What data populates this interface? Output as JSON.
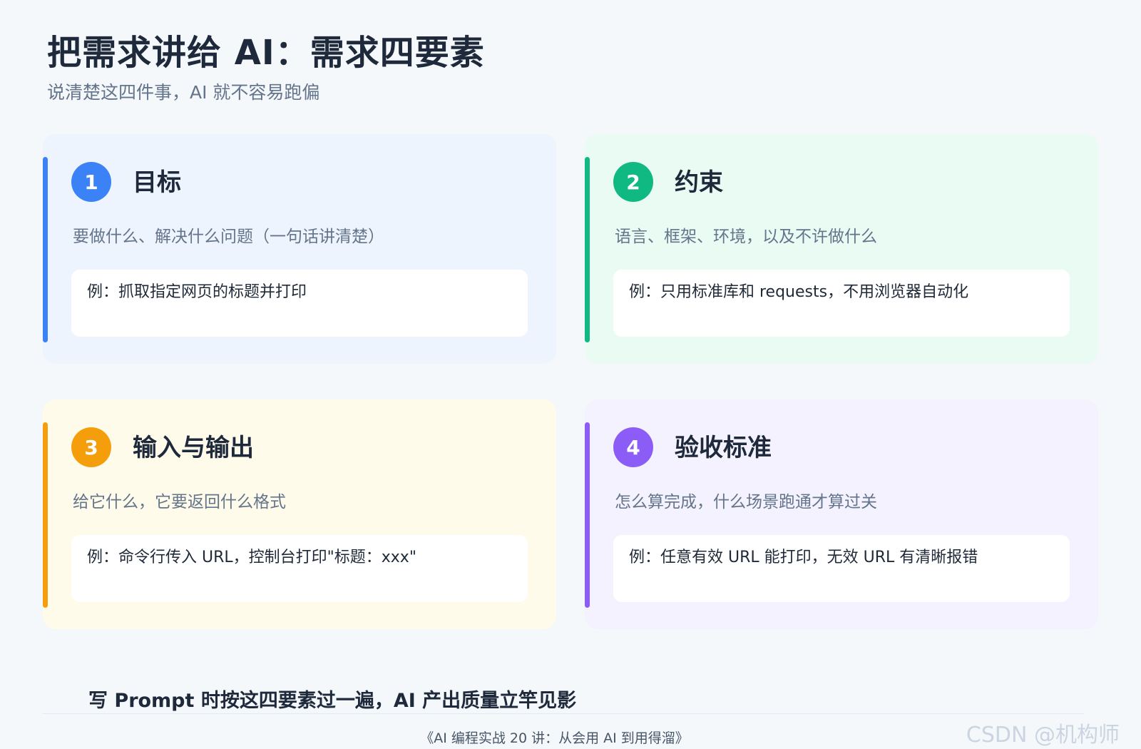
{
  "header": {
    "title": "把需求讲给 AI：需求四要素",
    "subtitle": "说清楚这四件事，AI 就不容易跑偏"
  },
  "cards": [
    {
      "number": "1",
      "title": "目标",
      "description": "要做什么、解决什么问题（一句话讲清楚）",
      "example": "例：抓取指定网页的标题并打印",
      "accent": "#3b82f6"
    },
    {
      "number": "2",
      "title": "约束",
      "description": "语言、框架、环境，以及不许做什么",
      "example": "例：只用标准库和 requests，不用浏览器自动化",
      "accent": "#10b981"
    },
    {
      "number": "3",
      "title": "输入与输出",
      "description": "给它什么，它要返回什么格式",
      "example": "例：命令行传入 URL，控制台打印\"标题：xxx\"",
      "accent": "#f59e0b"
    },
    {
      "number": "4",
      "title": "验收标准",
      "description": "怎么算完成，什么场景跑通才算过关",
      "example": "例：任意有效 URL 能打印，无效 URL 有清晰报错",
      "accent": "#8b5cf6"
    }
  ],
  "footer": {
    "note": "写 Prompt 时按这四要素过一遍，AI 产出质量立竿见影",
    "series": "《AI 编程实战 20 讲：从会用 AI 到用得溜》",
    "watermark": "CSDN @机构师"
  }
}
